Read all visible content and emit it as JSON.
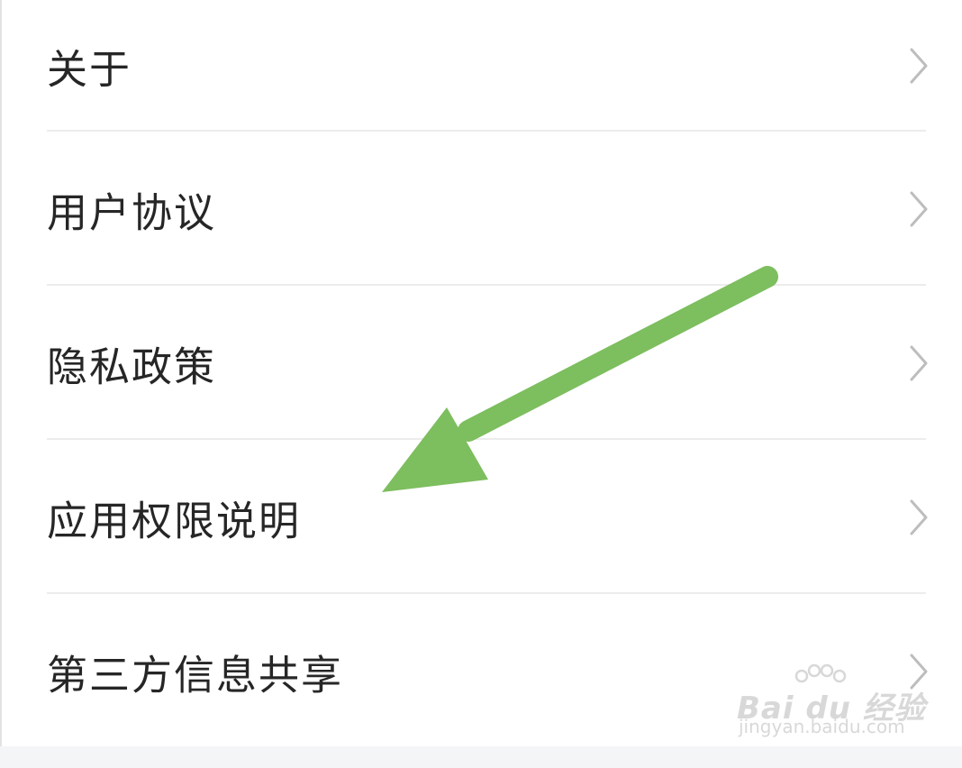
{
  "menu": {
    "items": [
      {
        "label": "关于",
        "chevron_icon": "chevron-right-icon"
      },
      {
        "label": "用户协议",
        "chevron_icon": "chevron-right-icon"
      },
      {
        "label": "隐私政策",
        "chevron_icon": "chevron-right-icon"
      },
      {
        "label": "应用权限说明",
        "chevron_icon": "chevron-right-icon"
      },
      {
        "label": "第三方信息共享",
        "chevron_icon": "chevron-right-icon"
      }
    ]
  },
  "annotation": {
    "icon": "arrow-pointer-icon",
    "color": "#7dbe5f",
    "points_to": "应用权限说明"
  },
  "watermark": {
    "brand": "Bai du 经验",
    "url": "jingyan.baidu.com"
  },
  "colors": {
    "text": "#262626",
    "chevron": "#bdbdbd",
    "divider": "#ececec",
    "arrow": "#7dbe5f"
  }
}
